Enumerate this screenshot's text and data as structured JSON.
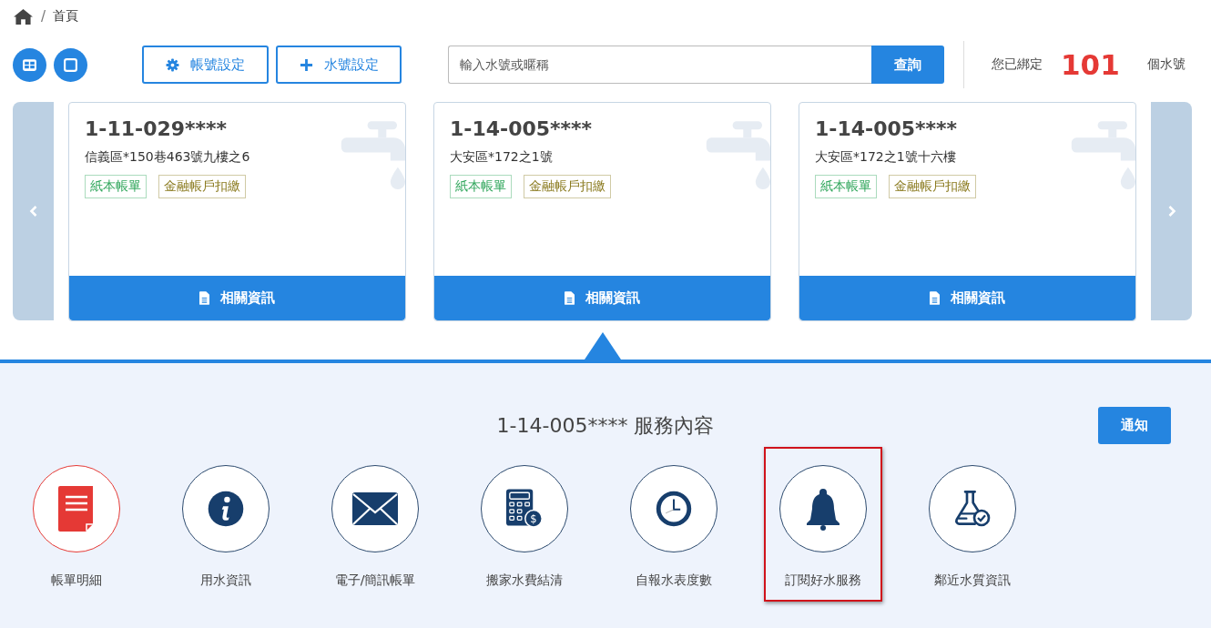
{
  "breadcrumb": {
    "separator": "/",
    "items": [
      "首頁"
    ]
  },
  "toolbar": {
    "buttons": [
      {
        "kind": "gear",
        "label": "帳號設定"
      },
      {
        "kind": "plus",
        "label": "水號設定"
      }
    ],
    "search": {
      "placeholder": "輸入水號或暱稱",
      "button": "查詢"
    },
    "bound": {
      "prefix": "您已綁定",
      "count": "101",
      "suffix": "個水號"
    }
  },
  "cards": [
    {
      "number": "1-11-029****",
      "address": "信義區*150巷463號九樓之6",
      "tags": [
        {
          "label": "紙本帳單",
          "color": "#2ea55a"
        },
        {
          "label": "金融帳戶扣繳",
          "color": "#8a7a1e"
        }
      ],
      "button": "相關資訊",
      "selected": false
    },
    {
      "number": "1-14-005****",
      "address": "大安區*172之1號",
      "tags": [
        {
          "label": "紙本帳單",
          "color": "#2ea55a"
        },
        {
          "label": "金融帳戶扣繳",
          "color": "#8a7a1e"
        }
      ],
      "button": "相關資訊",
      "selected": true
    },
    {
      "number": "1-14-005****",
      "address": "大安區*172之1號十六樓",
      "tags": [
        {
          "label": "紙本帳單",
          "color": "#2ea55a"
        },
        {
          "label": "金融帳戶扣繳",
          "color": "#8a7a1e"
        }
      ],
      "button": "相關資訊",
      "selected": false
    }
  ],
  "services": {
    "title": "1-14-005**** 服務內容",
    "notify_button": "通知",
    "items": [
      {
        "kind": "bill",
        "label": "帳單明細",
        "selected": true,
        "highlighted": false
      },
      {
        "kind": "info",
        "label": "用水資訊",
        "selected": false,
        "highlighted": false
      },
      {
        "kind": "mail",
        "label": "電子/簡訊帳單",
        "selected": false,
        "highlighted": false
      },
      {
        "kind": "calculator",
        "icon_text": "$",
        "label": "搬家水費結清",
        "selected": false,
        "highlighted": false
      },
      {
        "kind": "clock",
        "label": "自報水表度數",
        "selected": false,
        "highlighted": false
      },
      {
        "kind": "bell",
        "label": "訂閱好水服務",
        "selected": false,
        "highlighted": true
      },
      {
        "kind": "flask",
        "label": "鄰近水質資訊",
        "selected": false,
        "highlighted": false
      }
    ]
  }
}
